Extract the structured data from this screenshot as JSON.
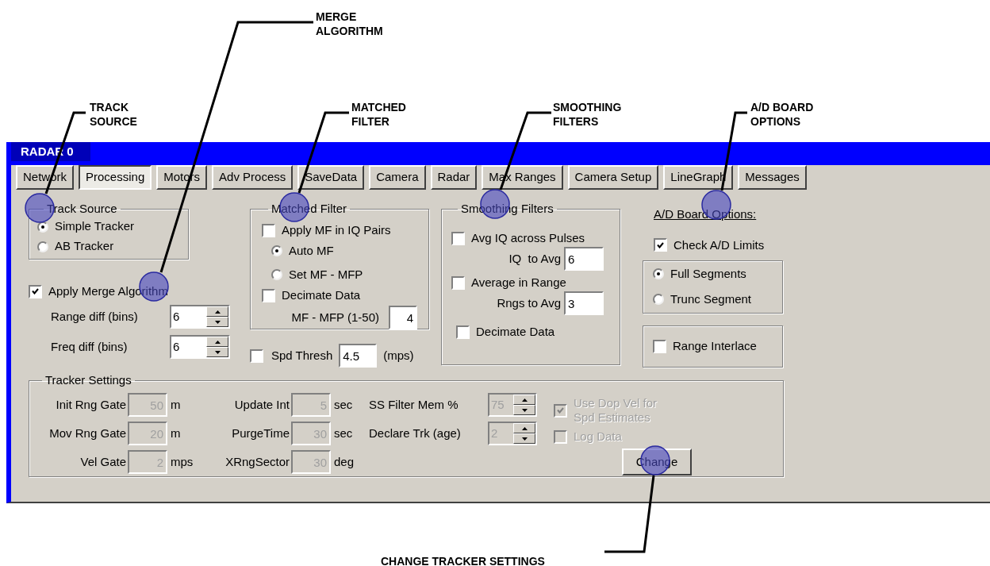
{
  "callouts": [
    {
      "label": "MERGE\nALGORITHM"
    },
    {
      "label": "TRACK\nSOURCE"
    },
    {
      "label": "MATCHED\nFILTER"
    },
    {
      "label": "SMOOTHING\nFILTERS"
    },
    {
      "label": "A/D BOARD\nOPTIONS"
    },
    {
      "label": "CHANGE TRACKER SETTINGS"
    }
  ],
  "window": {
    "title": "RADAR 0"
  },
  "tabs": [
    {
      "label": "Network",
      "selected": false
    },
    {
      "label": "Processing",
      "selected": true
    },
    {
      "label": "Motors",
      "selected": false
    },
    {
      "label": "Adv Process",
      "selected": false
    },
    {
      "label": "SaveData",
      "selected": false
    },
    {
      "label": "Camera",
      "selected": false
    },
    {
      "label": "Radar",
      "selected": false
    },
    {
      "label": "Max Ranges",
      "selected": false
    },
    {
      "label": "Camera Setup",
      "selected": false
    },
    {
      "label": "LineGraph",
      "selected": false
    },
    {
      "label": "Messages",
      "selected": false
    }
  ],
  "track_source": {
    "title": "Track Source",
    "options": [
      {
        "label": "Simple Tracker",
        "selected": true
      },
      {
        "label": "AB Tracker",
        "selected": false
      }
    ]
  },
  "merge": {
    "label": "Apply Merge Algorithm",
    "checked": true,
    "fields": [
      {
        "label": "Range diff (bins)",
        "value": "6"
      },
      {
        "label": "Freq diff (bins)",
        "value": "6"
      }
    ]
  },
  "matched_filter": {
    "title": "Matched Filter",
    "apply": {
      "label": "Apply MF in IQ Pairs",
      "checked": false
    },
    "modes": [
      {
        "label": "Auto MF",
        "selected": true
      },
      {
        "label": "Set MF - MFP",
        "selected": false
      }
    ],
    "decimate": {
      "label": "Decimate Data",
      "checked": false
    },
    "field": {
      "label": "MF - MFP (1-50)",
      "value": "4"
    }
  },
  "speed_threshold": {
    "label": "Spd Thresh",
    "checked": false,
    "value": "4.5",
    "unit": "(mps)"
  },
  "smoothing": {
    "title": "Smoothing Filters",
    "items": [
      {
        "kind": "checkbox_field",
        "label": "Avg IQ across Pulses",
        "checked": false,
        "field_label": "IQ  to Avg",
        "value": "6"
      },
      {
        "kind": "checkbox_field",
        "label": "Average in Range",
        "checked": false,
        "field_label": "Rngs to Avg",
        "value": "3"
      },
      {
        "kind": "checkbox",
        "label": "Decimate Data",
        "checked": false
      }
    ]
  },
  "ad_board": {
    "title": "A/D Board Options:",
    "check_limits": {
      "label": "Check A/D Limits",
      "checked": true
    },
    "segments": [
      {
        "label": "Full Segments",
        "selected": true
      },
      {
        "label": "Trunc Segment",
        "selected": false
      }
    ],
    "range_interlace": {
      "label": "Range Interlace",
      "checked": false
    }
  },
  "tracker": {
    "title": "Tracker Settings",
    "columns": [
      [
        {
          "label": "Init Rng Gate",
          "value": "50",
          "unit": "m",
          "disabled": true
        },
        {
          "label": "Mov Rng Gate",
          "value": "20",
          "unit": "m",
          "disabled": true
        },
        {
          "label": "Vel Gate",
          "value": "2",
          "unit": "mps",
          "disabled": true
        }
      ],
      [
        {
          "label": "Update Int",
          "value": "5",
          "unit": "sec",
          "disabled": true
        },
        {
          "label": "PurgeTime",
          "value": "30",
          "unit": "sec",
          "disabled": true
        },
        {
          "label": "XRngSector",
          "value": "30",
          "unit": "deg",
          "disabled": true
        }
      ]
    ],
    "spinners": [
      {
        "label": "SS Filter Mem %",
        "value": "75",
        "disabled": true
      },
      {
        "label": "Declare Trk (age)",
        "value": "2",
        "disabled": true
      }
    ],
    "options": [
      {
        "label": "Use Dop Vel for\nSpd Estimates",
        "checked": true,
        "disabled": true
      },
      {
        "label": "Log Data",
        "checked": false,
        "disabled": true
      }
    ],
    "button": "Change"
  }
}
